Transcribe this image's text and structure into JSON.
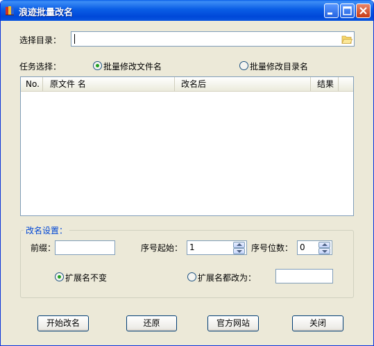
{
  "window": {
    "title": "浪迹批量改名"
  },
  "directory": {
    "label": "选择目录：",
    "value": ""
  },
  "task": {
    "label": "任务选择：",
    "options": [
      {
        "label": "批量修改文件名",
        "checked": true
      },
      {
        "label": "批量修改目录名",
        "checked": false
      }
    ]
  },
  "table": {
    "columns": [
      "No.",
      "原文件 名",
      "改名后",
      "结果"
    ],
    "rows": []
  },
  "rename": {
    "group_title": "改名设置：",
    "prefix_label": "前缀：",
    "prefix_value": "",
    "seq_start_label": "序号起始：",
    "seq_start_value": "1",
    "seq_digits_label": "序号位数：",
    "seq_digits_value": "0",
    "ext_keep_label": "扩展名不变",
    "ext_change_label": "扩展名都改为：",
    "ext_change_value": ""
  },
  "buttons": {
    "start": "开始改名",
    "restore": "还原",
    "website": "官方网站",
    "close": "关闭"
  }
}
